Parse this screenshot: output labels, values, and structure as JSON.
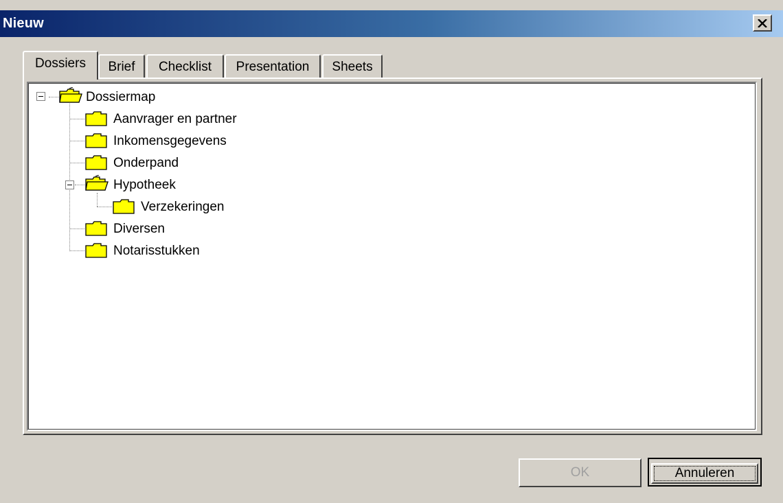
{
  "window": {
    "title": "Nieuw"
  },
  "tabs": [
    {
      "label": "Dossiers",
      "active": true
    },
    {
      "label": "Brief",
      "active": false
    },
    {
      "label": "Checklist",
      "active": false
    },
    {
      "label": "Presentation",
      "active": false
    },
    {
      "label": "Sheets",
      "active": false
    }
  ],
  "tree": {
    "root": {
      "label": "Dossiermap",
      "children": [
        {
          "label": "Aanvrager en partner"
        },
        {
          "label": "Inkomensgegevens"
        },
        {
          "label": "Onderpand"
        },
        {
          "label": "Hypotheek",
          "children": [
            {
              "label": "Verzekeringen"
            }
          ]
        },
        {
          "label": "Diversen"
        },
        {
          "label": "Notarisstukken"
        }
      ]
    }
  },
  "buttons": {
    "ok": "OK",
    "cancel": "Annuleren"
  },
  "colors": {
    "folder": "#ffff00",
    "title_start": "#0a246a",
    "title_end": "#a6caf0",
    "face": "#d4d0c8"
  },
  "icons": {
    "folder": "folder-icon",
    "open_folder": "open-folder-icon",
    "close": "close-icon",
    "collapse": "collapse-toggle-icon"
  }
}
